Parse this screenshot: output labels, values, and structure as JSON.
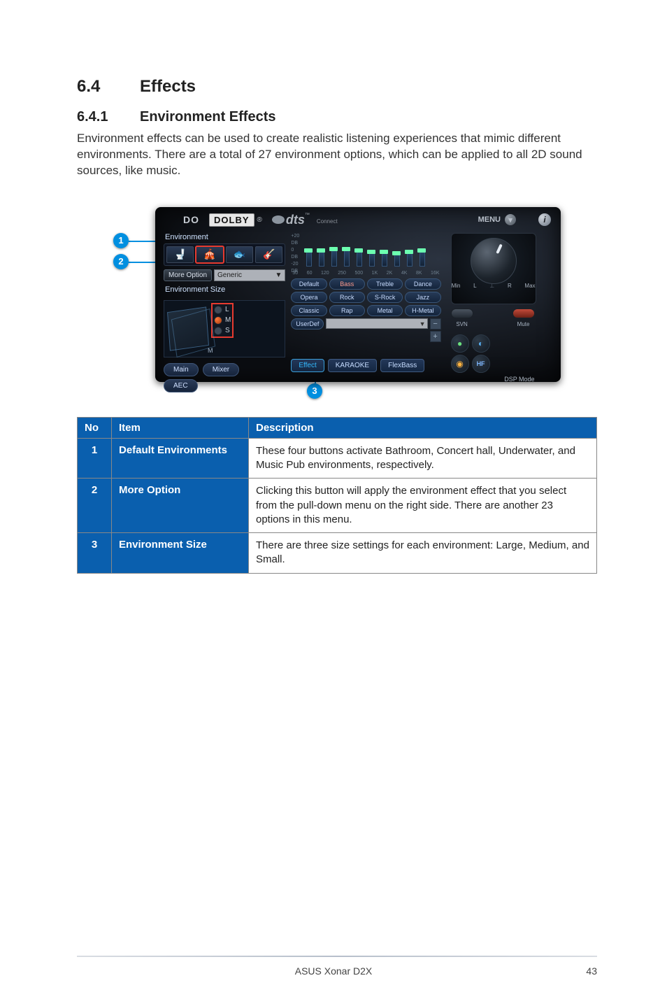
{
  "section": {
    "number": "6.4",
    "title": "Effects"
  },
  "subsection": {
    "number": "6.4.1",
    "title": "Environment Effects"
  },
  "paragraph": "Environment effects can be used to create realistic listening experiences that mimic different environments. There are a total of 27 environment options, which can be applied to all 2D sound sources, like music.",
  "shot": {
    "brand": {
      "dolby_prefix": "DO",
      "dolby": "DOLBY",
      "reg": "®",
      "dts": "dts",
      "tm": "™",
      "connect": "Connect"
    },
    "menu_label": "MENU",
    "left": {
      "environment_label": "Environment",
      "more_option_label": "More Option",
      "more_option_value": "Generic",
      "env_size_label": "Environment Size",
      "lms": {
        "L": "L",
        "M": "M",
        "S": "S"
      },
      "tabs": {
        "main": "Main",
        "mixer": "Mixer",
        "aec": "AEC"
      }
    },
    "eq": {
      "db_labels": [
        "+20",
        "DB",
        "0",
        "DB",
        "-20",
        "DB"
      ],
      "freq_labels": [
        "30",
        "60",
        "120",
        "250",
        "500",
        "1K",
        "2K",
        "4K",
        "8K",
        "16K"
      ],
      "presets": [
        "Default",
        "Bass",
        "Treble",
        "Dance",
        "Opera",
        "Rock",
        "S-Rock",
        "Jazz",
        "Classic",
        "Rap",
        "Metal",
        "H-Metal"
      ],
      "userdef": "UserDef"
    },
    "tabs2": {
      "effect": "Effect",
      "karaoke": "KARAOKE",
      "flexbass": "FlexBass"
    },
    "right": {
      "min": "Min",
      "max": "Max",
      "L": "L",
      "R": "R",
      "svn": "SVN",
      "mute": "Mute",
      "dsp": "DSP Mode",
      "hf": "HF"
    }
  },
  "callouts": {
    "c1": "1",
    "c2": "2",
    "c3": "3"
  },
  "table": {
    "headers": {
      "no": "No",
      "item": "Item",
      "desc": "Description"
    },
    "rows": [
      {
        "no": "1",
        "item": "Default Environments",
        "desc": "These four buttons activate Bathroom, Concert hall, Underwater, and Music Pub environments, respectively."
      },
      {
        "no": "2",
        "item": "More Option",
        "desc": "Clicking this button will apply the environment effect that you select from the pull-down menu on the right side. There are another 23 options in this menu."
      },
      {
        "no": "3",
        "item": "Environment Size",
        "desc": "There are three size settings for each environment: Large, Medium, and Small."
      }
    ]
  },
  "footer": {
    "product": "ASUS Xonar D2X",
    "page": "43"
  }
}
